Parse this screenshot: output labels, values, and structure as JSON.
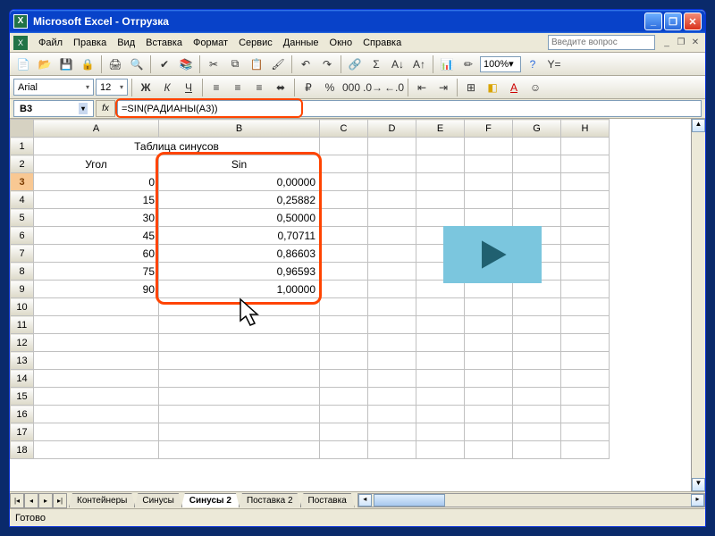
{
  "titlebar": {
    "app": "Microsoft Excel",
    "doc": "Отгрузка"
  },
  "menu": {
    "file": "Файл",
    "edit": "Правка",
    "view": "Вид",
    "insert": "Вставка",
    "format": "Формат",
    "tools": "Сервис",
    "data": "Данные",
    "window": "Окно",
    "help": "Справка",
    "help_placeholder": "Введите вопрос"
  },
  "toolbar": {
    "zoom": "100%"
  },
  "format": {
    "font": "Arial",
    "size": "12"
  },
  "formula": {
    "cell_ref": "B3",
    "fx_label": "fx",
    "content": "=SIN(РАДИАНЫ(A3))"
  },
  "columns": [
    "A",
    "B",
    "C",
    "D",
    "E",
    "F",
    "G",
    "H"
  ],
  "sheet": {
    "title": "Таблица синусов",
    "headers": {
      "angle": "Угол",
      "sin": "Sin"
    },
    "rows": [
      {
        "n": 3,
        "angle": "0",
        "sin": "0,00000"
      },
      {
        "n": 4,
        "angle": "15",
        "sin": "0,25882"
      },
      {
        "n": 5,
        "angle": "30",
        "sin": "0,50000"
      },
      {
        "n": 6,
        "angle": "45",
        "sin": "0,70711"
      },
      {
        "n": 7,
        "angle": "60",
        "sin": "0,86603"
      },
      {
        "n": 8,
        "angle": "75",
        "sin": "0,96593"
      },
      {
        "n": 9,
        "angle": "90",
        "sin": "1,00000"
      }
    ],
    "empty_rows": [
      10,
      11,
      12,
      13,
      14,
      15,
      16,
      17,
      18
    ]
  },
  "tabs": {
    "items": [
      "Контейнеры",
      "Синусы",
      "Синусы 2",
      "Поставка 2",
      "Поставка"
    ],
    "active_index": 2
  },
  "status": {
    "ready": "Готово"
  },
  "colors": {
    "highlight": "#ff4400",
    "play_bg": "#7bc6de",
    "play_fg": "#206070"
  }
}
